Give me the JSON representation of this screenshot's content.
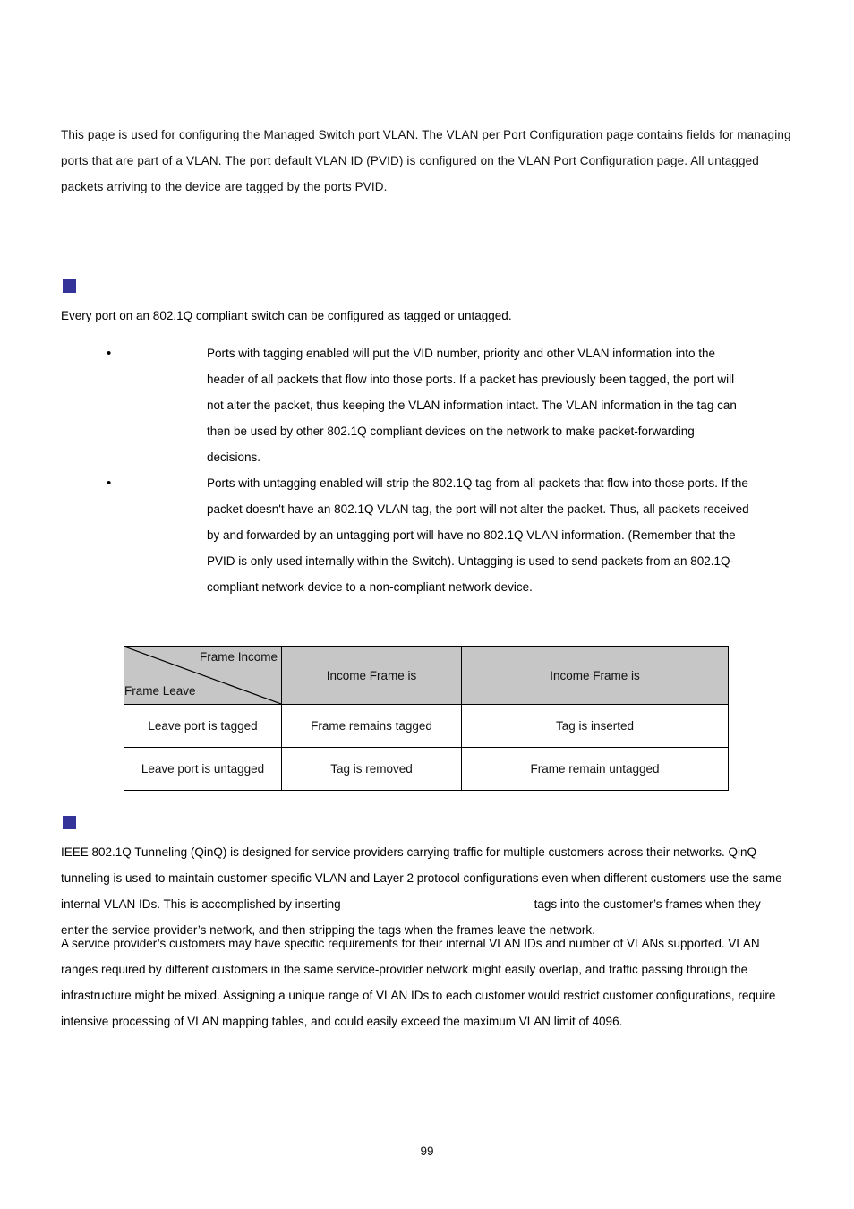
{
  "document": {
    "page_number": "99",
    "accent_color": "#333399",
    "table_header_bg": "#c6c6c6"
  },
  "intro": {
    "paragraph": "This page is used for configuring the Managed Switch port VLAN. The VLAN per Port Configuration page contains fields for managing ports that are part of a VLAN. The port default VLAN ID (PVID) is configured on the VLAN Port Configuration page. All untagged packets arriving to the device are tagged by the ports PVID."
  },
  "section_tagging": {
    "marker": "square-bullet",
    "heading": "",
    "lead": "Every port on an 802.1Q compliant switch can be configured as tagged or untagged.",
    "bullets": [
      {
        "marker": "•",
        "text": "Ports with tagging enabled will put the VID number, priority and other VLAN information into the header of all packets that flow into those ports. If a packet has previously been tagged, the port will not alter the packet, thus keeping the VLAN information intact. The VLAN information in the tag can then be used by other 802.1Q compliant devices on the network to make packet-forwarding decisions."
      },
      {
        "marker": "•",
        "text": "Ports with untagging enabled will strip the 802.1Q tag from all packets that flow into those ports. If the packet doesn't have an 802.1Q VLAN tag, the port will not alter the packet. Thus, all packets received by and forwarded by an untagging port will have no 802.1Q VLAN information. (Remember that the PVID is only used internally within the Switch). Untagging is used to send packets from an 802.1Q-compliant network device to a non-compliant network device."
      }
    ]
  },
  "frame_table": {
    "corner": {
      "top_right_label": "Frame Income",
      "bottom_left_label": "Frame Leave"
    },
    "column_headers": [
      "Income Frame is",
      "Income Frame is"
    ],
    "rows": [
      {
        "row_header": "Leave port is tagged",
        "cells": [
          "Frame remains tagged",
          "Tag is inserted"
        ]
      },
      {
        "row_header": "Leave port is untagged",
        "cells": [
          "Tag is removed",
          "Frame remain untagged"
        ]
      }
    ]
  },
  "section_qinq": {
    "marker": "square-bullet",
    "heading": "",
    "paragraph_1_part_a": "IEEE 802.1Q Tunneling (QinQ) is designed for service providers carrying traffic for multiple customers across their networks. QinQ tunneling is used to maintain customer-specific VLAN and Layer 2 protocol configurations even when different customers use the same internal VLAN IDs. This is accomplished by inserting",
    "paragraph_1_gap": "",
    "paragraph_1_part_b": "tags into the customer’s frames when they enter the service provider’s network, and then stripping the tags when the frames leave the network.",
    "paragraph_2": "A service provider’s customers may have specific requirements for their internal VLAN IDs and number of VLANs supported. VLAN ranges required by different customers in the same service-provider network might easily overlap, and traffic passing through the infrastructure might be mixed. Assigning a unique range of VLAN IDs to each customer would restrict customer configurations, require intensive processing of VLAN mapping tables, and could easily exceed the maximum VLAN limit of 4096."
  }
}
